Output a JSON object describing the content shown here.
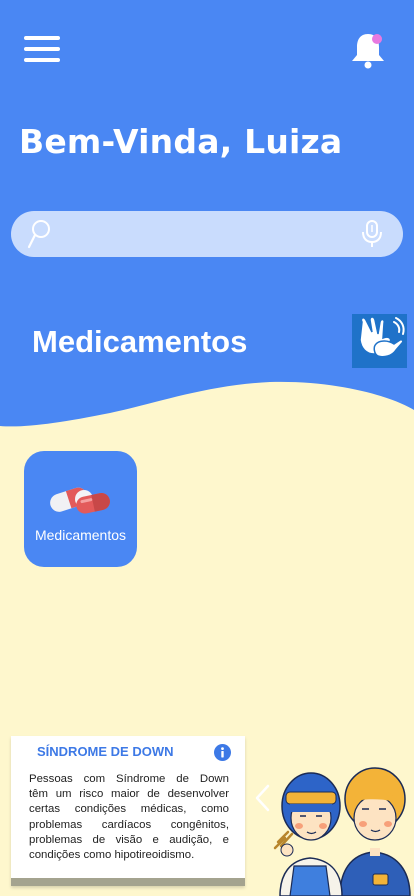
{
  "header": {
    "greeting": "Bem-Vinda, Luiza",
    "menu_icon": "hamburger-menu-icon",
    "notification_icon": "bell-icon"
  },
  "search": {
    "value": "",
    "placeholder": "",
    "search_icon": "search-icon",
    "voice_icon": "microphone-icon"
  },
  "section": {
    "title": "Medicamentos",
    "accessibility_icon": "sign-language-icon"
  },
  "tiles": [
    {
      "label": "Medicamentos",
      "icon": "pill-icon"
    }
  ],
  "info_card": {
    "title": "SÍNDROME DE DOWN",
    "icon": "info-icon",
    "lines": [
      "Pessoas com Síndrome de Down",
      "têm um risco maior de desenvolver",
      "certas condições médicas, como",
      "problemas cardíacos congênitos,",
      "problemas de visão e audição, e",
      "condições como hipotireoidismo."
    ]
  },
  "carousel": {
    "prev_icon": "chevron-left-icon",
    "illustration": "children-illustration"
  },
  "colors": {
    "primary": "#4a87f3",
    "background": "#fef7cd",
    "search_bg": "#c9dcfd",
    "badge": "#e879e0"
  }
}
